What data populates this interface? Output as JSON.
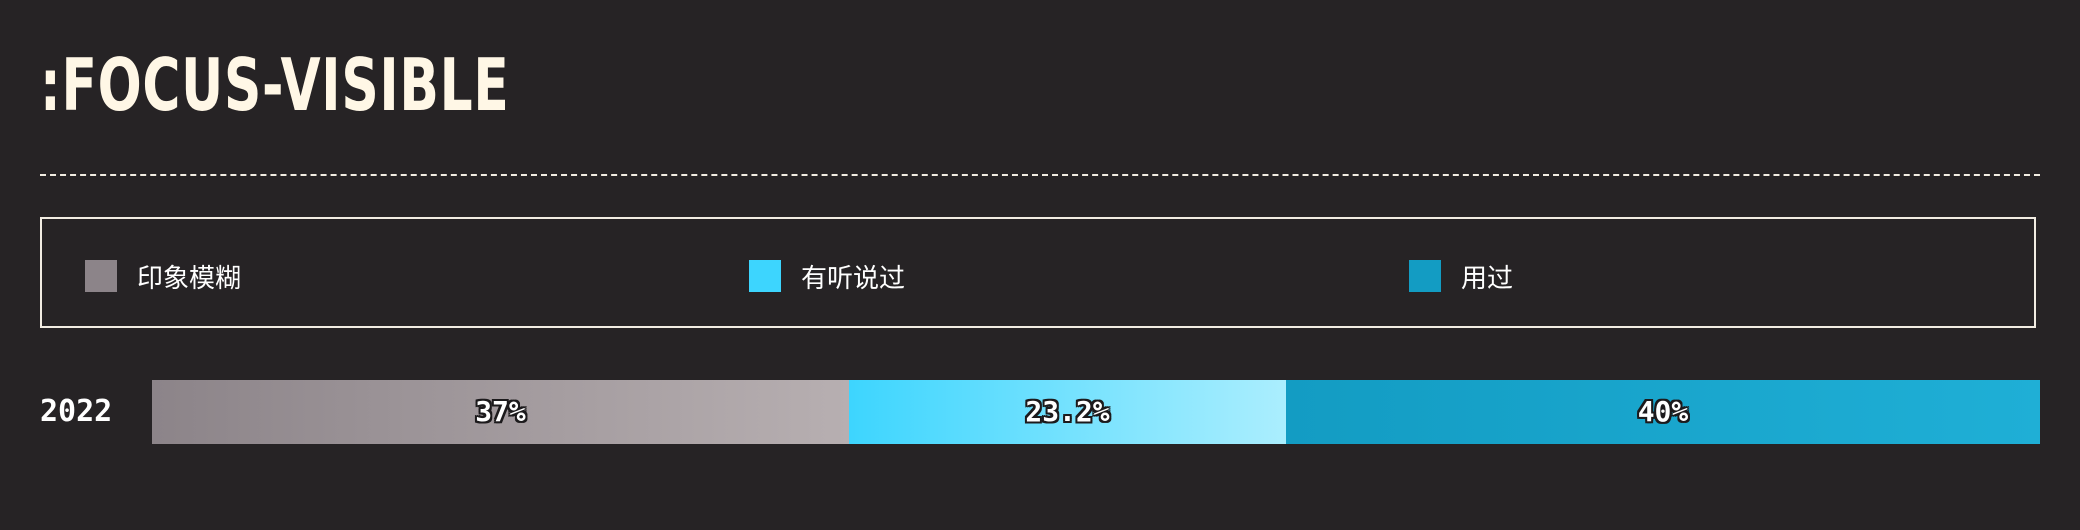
{
  "title": ":FOCUS-VISIBLE",
  "chart_data": {
    "type": "bar",
    "orientation": "horizontal",
    "stacked": true,
    "categories": [
      "2022"
    ],
    "series": [
      {
        "name": "印象模糊",
        "values": [
          37
        ],
        "label": "37%",
        "color": "#8c8489",
        "color_end": "#b7afb1"
      },
      {
        "name": "有听说过",
        "values": [
          23.2
        ],
        "label": "23.2%",
        "color": "#3dd5fe",
        "color_end": "#abeefe"
      },
      {
        "name": "用过",
        "values": [
          40
        ],
        "label": "40%",
        "color": "#139cc3",
        "color_end": "#1fafd6"
      }
    ],
    "xlim": [
      0,
      100.2
    ],
    "legend_position": "top",
    "grid": false
  }
}
